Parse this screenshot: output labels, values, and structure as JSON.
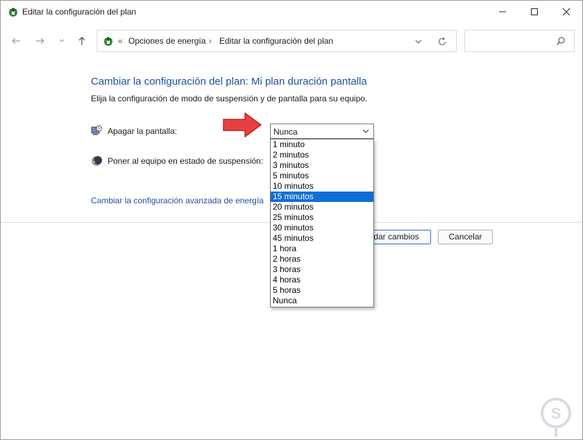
{
  "window": {
    "title": "Editar la configuración del plan"
  },
  "nav": {
    "breadcrumb_overflow": "«",
    "breadcrumb": [
      "Opciones de energía",
      "Editar la configuración del plan"
    ],
    "search_placeholder": ""
  },
  "content": {
    "heading": "Cambiar la configuración del plan: Mi plan duración pantalla",
    "subtext": "Elija la configuración de modo de suspensión y de pantalla para su equipo.",
    "display_label": "Apagar la pantalla:",
    "sleep_label": "Poner al equipo en estado de suspensión:",
    "display_value": "Nunca",
    "advanced_link": "Cambiar la configuración avanzada de energía"
  },
  "buttons": {
    "save_visible": "dar cambios",
    "cancel": "Cancelar"
  },
  "dropdown": {
    "options": [
      "1 minuto",
      "2 minutos",
      "3 minutos",
      "5 minutos",
      "10 minutos",
      "15 minutos",
      "20 minutos",
      "25 minutos",
      "30 minutos",
      "45 minutos",
      "1 hora",
      "2 horas",
      "3 horas",
      "4 horas",
      "5 horas",
      "Nunca"
    ],
    "highlighted": "15 minutos"
  },
  "colors": {
    "accent": "#0f6fd6",
    "link": "#1f4e9c",
    "arrow": "#e84040"
  },
  "icons": [
    "power-options-icon",
    "back-arrow-icon",
    "forward-arrow-icon",
    "chevron-down-icon",
    "up-arrow-icon",
    "refresh-icon",
    "search-icon",
    "monitor-clock-icon",
    "moon-sleep-icon",
    "red-arrow-icon",
    "watermark-logo"
  ]
}
